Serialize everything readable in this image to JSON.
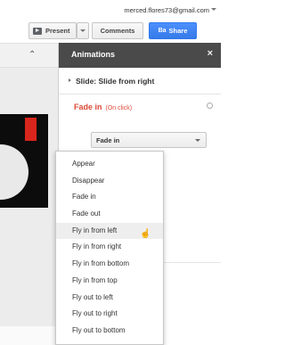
{
  "header": {
    "account_email": "merced.flores73@gmail.com",
    "present_label": "Present",
    "comments_label": "Comments",
    "share_label": "Share",
    "share_icon": "Ba",
    "collapse_icon": "»"
  },
  "panel": {
    "title": "Animations",
    "close_icon": "×",
    "slide_transition": "Slide: Slide from right",
    "animation_name": "Fade in",
    "animation_trigger": "(On click)",
    "effect_select_value": "Fade in"
  },
  "effect_menu": {
    "items": [
      "Appear",
      "Disappear",
      "Fade in",
      "Fade out",
      "Fly in from left",
      "Fly in from right",
      "Fly in from bottom",
      "Fly in from top",
      "Fly out to left",
      "Fly out to right",
      "Fly out to bottom"
    ],
    "hovered_item": "Fly in from left",
    "cursor_icon": "hand-pointer-icon"
  },
  "colors": {
    "panel_header_bg": "#4a4a4a",
    "share_button_bg": "#4d90fe",
    "animation_title_color": "#dd4b39",
    "slide_accent_red": "#d9261c"
  }
}
